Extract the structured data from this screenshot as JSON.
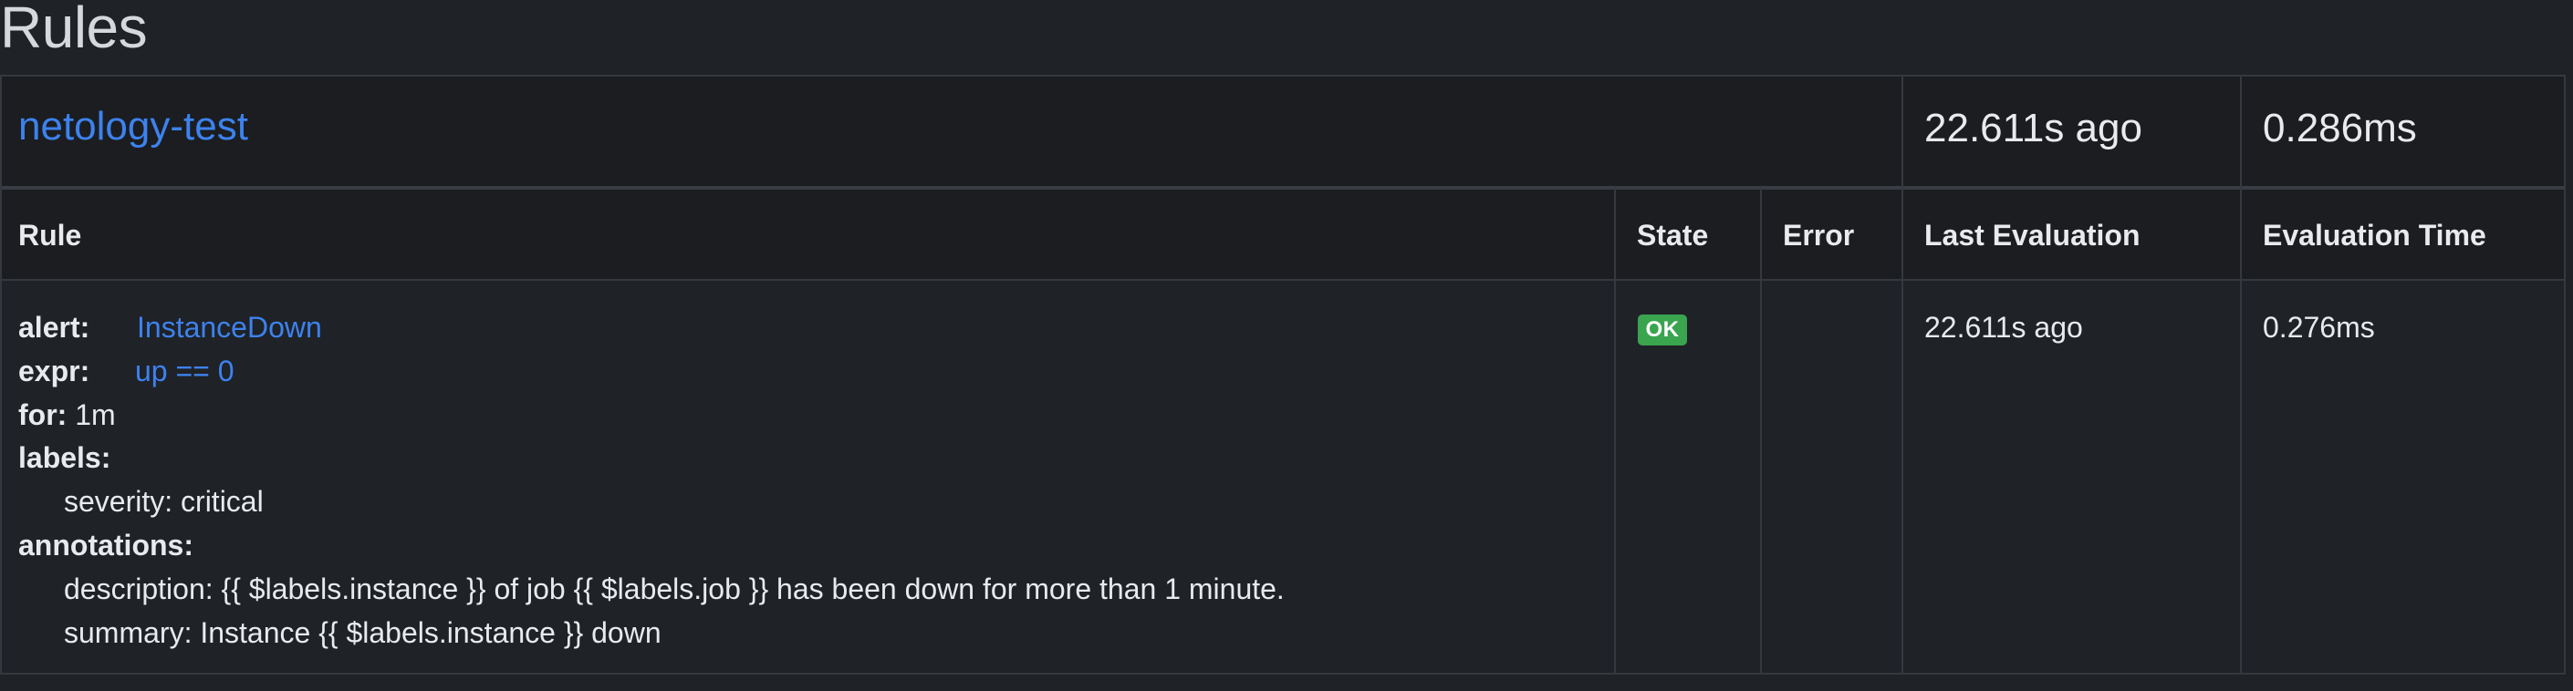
{
  "page": {
    "title": "Rules"
  },
  "group": {
    "name": "netology-test",
    "last_evaluation": "22.611s ago",
    "evaluation_time": "0.286ms"
  },
  "table": {
    "headers": {
      "rule": "Rule",
      "state": "State",
      "error": "Error",
      "last_evaluation": "Last Evaluation",
      "evaluation_time": "Evaluation Time"
    },
    "rows": [
      {
        "rule": {
          "alert_key": "alert:",
          "alert_name": "InstanceDown",
          "expr_key": "expr:",
          "expr_value": "up == 0",
          "for_key": "for:",
          "for_value": "1m",
          "labels_key": "labels:",
          "labels": [
            "severity: critical"
          ],
          "annotations_key": "annotations:",
          "annotations": [
            "description: {{ $labels.instance }} of job {{ $labels.job }} has been down for more than 1 minute.",
            "summary: Instance {{ $labels.instance }} down"
          ]
        },
        "state": "OK",
        "state_color": "#3aa44f",
        "error": "",
        "last_evaluation": "22.611s ago",
        "evaluation_time": "0.276ms"
      }
    ]
  },
  "colors": {
    "background": "#1f2226",
    "link": "#3d82ee",
    "border": "#35393f"
  }
}
